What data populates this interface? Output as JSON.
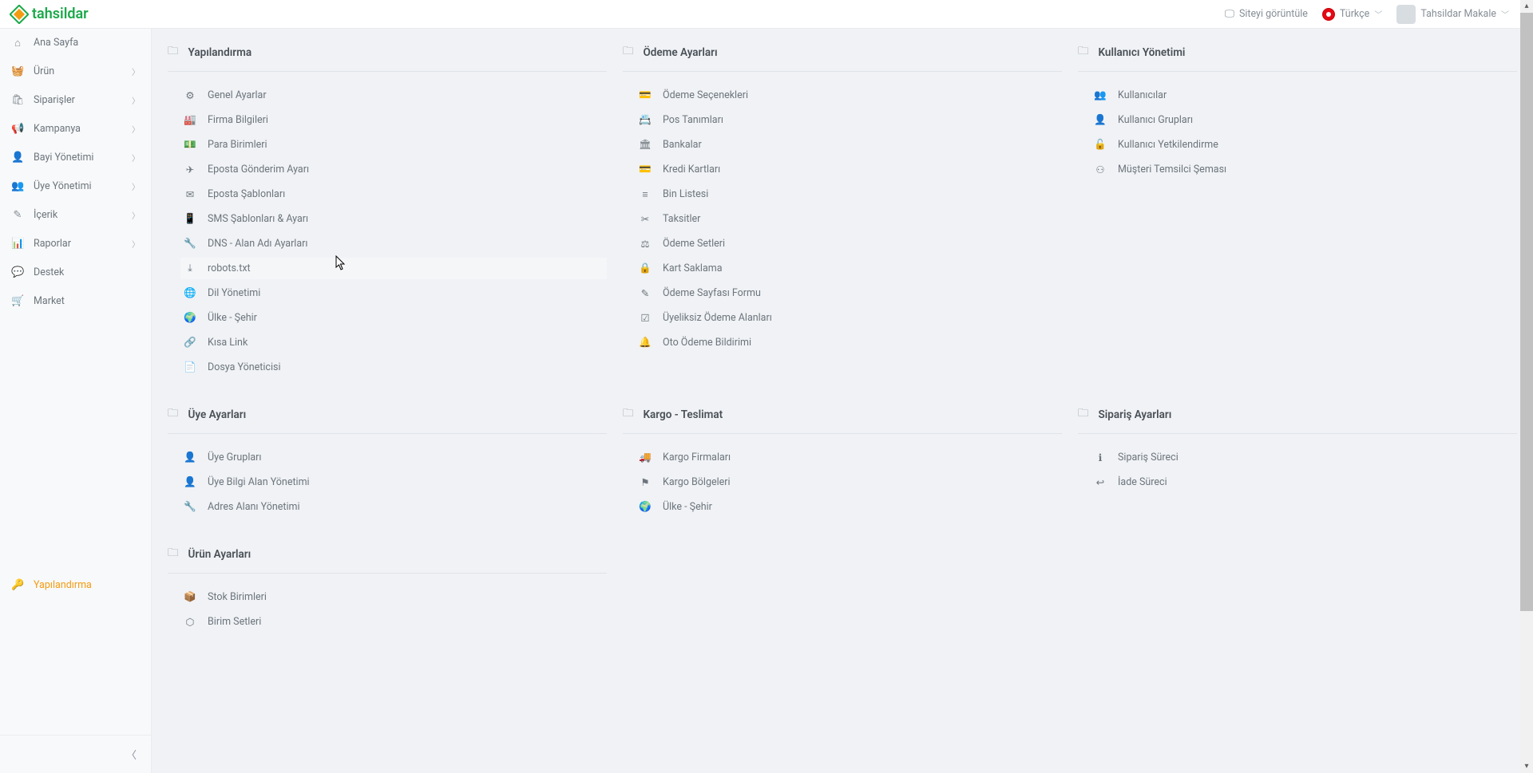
{
  "header": {
    "logo_text": "tahsildar",
    "view_site": "Siteyi görüntüle",
    "language": "Türkçe",
    "user_name": "Tahsildar Makale"
  },
  "sidebar": {
    "items": [
      {
        "label": "Ana Sayfa",
        "icon": "⌂",
        "expandable": false,
        "active": false
      },
      {
        "label": "Ürün",
        "icon": "🧺",
        "expandable": true,
        "active": false
      },
      {
        "label": "Siparişler",
        "icon": "🛍",
        "expandable": true,
        "active": false
      },
      {
        "label": "Kampanya",
        "icon": "📢",
        "expandable": true,
        "active": false
      },
      {
        "label": "Bayi Yönetimi",
        "icon": "👤",
        "expandable": true,
        "active": false
      },
      {
        "label": "Üye Yönetimi",
        "icon": "👥",
        "expandable": true,
        "active": false
      },
      {
        "label": "İçerik",
        "icon": "✎",
        "expandable": true,
        "active": false
      },
      {
        "label": "Raporlar",
        "icon": "📊",
        "expandable": true,
        "active": false
      },
      {
        "label": "Destek",
        "icon": "💬",
        "expandable": false,
        "active": false
      },
      {
        "label": "Market",
        "icon": "🛒",
        "expandable": false,
        "active": false
      }
    ],
    "active_item": {
      "label": "Yapılandırma",
      "icon": "🔑"
    }
  },
  "content": {
    "row1": [
      {
        "title": "Yapılandırma",
        "items": [
          {
            "icon": "⚙",
            "label": "Genel Ayarlar"
          },
          {
            "icon": "🏭",
            "label": "Firma Bilgileri"
          },
          {
            "icon": "💵",
            "label": "Para Birimleri"
          },
          {
            "icon": "✈",
            "label": "Eposta Gönderim Ayarı"
          },
          {
            "icon": "✉",
            "label": "Eposta Şablonları"
          },
          {
            "icon": "📱",
            "label": "SMS Şablonları & Ayarı"
          },
          {
            "icon": "🔧",
            "label": "DNS - Alan Adı Ayarları"
          },
          {
            "icon": "⤓",
            "label": "robots.txt",
            "hovered": true
          },
          {
            "icon": "🌐",
            "label": "Dil Yönetimi"
          },
          {
            "icon": "🌍",
            "label": "Ülke - Şehir"
          },
          {
            "icon": "🔗",
            "label": "Kısa Link"
          },
          {
            "icon": "📄",
            "label": "Dosya Yöneticisi"
          }
        ]
      },
      {
        "title": "Ödeme Ayarları",
        "items": [
          {
            "icon": "💳",
            "label": "Ödeme Seçenekleri"
          },
          {
            "icon": "📇",
            "label": "Pos Tanımları"
          },
          {
            "icon": "🏛",
            "label": "Bankalar"
          },
          {
            "icon": "💳",
            "label": "Kredi Kartları"
          },
          {
            "icon": "≡",
            "label": "Bin Listesi"
          },
          {
            "icon": "✂",
            "label": "Taksitler"
          },
          {
            "icon": "⚖",
            "label": "Ödeme Setleri"
          },
          {
            "icon": "🔒",
            "label": "Kart Saklama"
          },
          {
            "icon": "✎",
            "label": "Ödeme Sayfası Formu"
          },
          {
            "icon": "☑",
            "label": "Üyeliksiz Ödeme Alanları"
          },
          {
            "icon": "🔔",
            "label": "Oto Ödeme Bildirimi"
          }
        ]
      },
      {
        "title": "Kullanıcı Yönetimi",
        "items": [
          {
            "icon": "👥",
            "label": "Kullanıcılar"
          },
          {
            "icon": "👤",
            "label": "Kullanıcı Grupları"
          },
          {
            "icon": "🔓",
            "label": "Kullanıcı Yetkilendirme"
          },
          {
            "icon": "⚇",
            "label": "Müşteri Temsilci Şeması"
          }
        ]
      }
    ],
    "row2": [
      {
        "title": "Üye Ayarları",
        "items": [
          {
            "icon": "👤",
            "label": "Üye Grupları"
          },
          {
            "icon": "👤",
            "label": "Üye Bilgi Alan Yönetimi"
          },
          {
            "icon": "🔧",
            "label": "Adres Alanı Yönetimi"
          }
        ]
      },
      {
        "title": "Kargo - Teslimat",
        "items": [
          {
            "icon": "🚚",
            "label": "Kargo Firmaları"
          },
          {
            "icon": "⚑",
            "label": "Kargo Bölgeleri"
          },
          {
            "icon": "🌍",
            "label": "Ülke - Şehir"
          }
        ]
      },
      {
        "title": "Sipariş Ayarları",
        "items": [
          {
            "icon": "ℹ",
            "label": "Sipariş Süreci"
          },
          {
            "icon": "↩",
            "label": "İade Süreci"
          }
        ]
      }
    ],
    "row3": [
      {
        "title": "Ürün Ayarları",
        "items": [
          {
            "icon": "📦",
            "label": "Stok Birimleri"
          },
          {
            "icon": "⬡",
            "label": "Birim Setleri"
          }
        ]
      }
    ]
  }
}
